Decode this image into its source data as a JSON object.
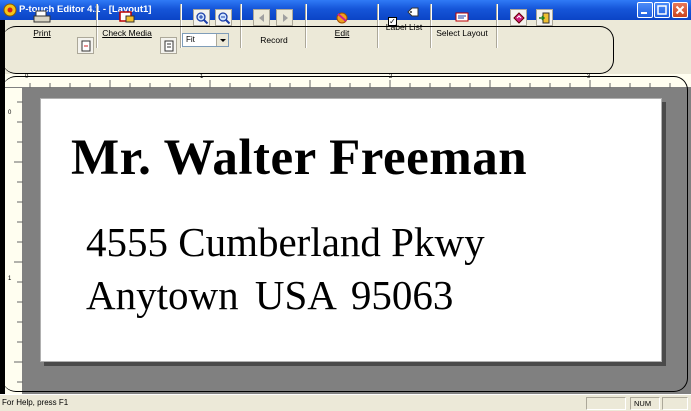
{
  "window": {
    "title": "P-touch Editor 4.1 - [Layout1]"
  },
  "toolbar": {
    "print_label": "Print",
    "check_media_label": "Check Media",
    "zoom_value": "Fit",
    "record_label": "Record",
    "edit_label": "Edit",
    "label_list_label": "Label List",
    "select_layout_label": "Select Layout"
  },
  "label": {
    "line1": "Mr. Walter Freeman",
    "line2": "4555 Cumberland Pkwy",
    "line3": "Anytown  USA   95063"
  },
  "rulers": {
    "top_marks": [
      "0",
      "1",
      "2",
      "3"
    ],
    "left_marks": [
      "0",
      "1"
    ]
  },
  "statusbar": {
    "help_text": "For Help, press F1",
    "num_indicator": "NUM"
  },
  "colors": {
    "titlebar": "#0b44c6",
    "workspace": "#808080",
    "toolbar_bg": "#ece9d8"
  },
  "icons": {
    "app": "ptouch-app-icon",
    "print": "printer-icon",
    "print_options": "print-options-icon",
    "check_media": "tape-media-icon",
    "media_options": "media-options-icon",
    "zoom_in": "zoom-in-icon",
    "zoom_out": "zoom-out-icon",
    "record_prev": "previous-record-icon",
    "record_next": "next-record-icon",
    "edit": "edit-icon",
    "label_list": "label-list-icon",
    "select_layout": "select-layout-icon",
    "help": "help-book-icon",
    "exit": "exit-door-icon"
  }
}
